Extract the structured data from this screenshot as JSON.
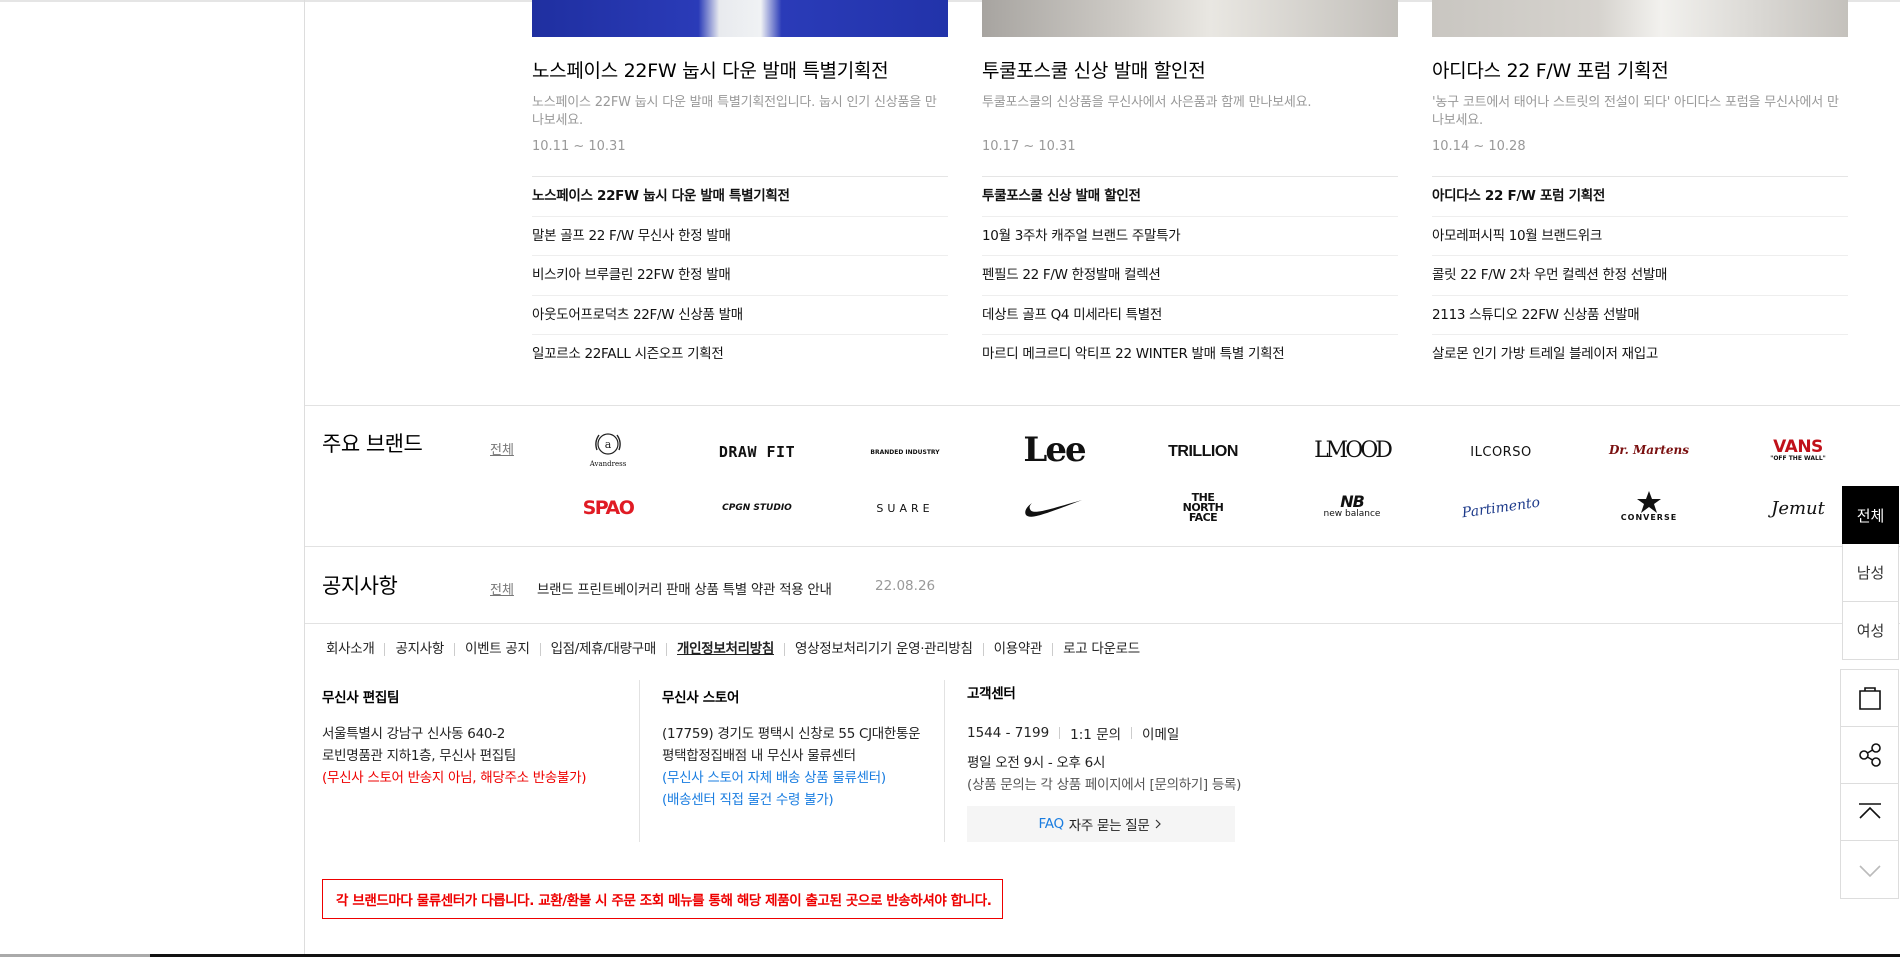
{
  "events": [
    {
      "title": "노스페이스 22FW 눕시 다운 발매 특별기획전",
      "desc": "노스페이스 22FW 눕시 다운 발매 특별기획전입니다. 눕시 인기 신상품을 만나보세요.",
      "date": "10.11 ~ 10.31",
      "links": [
        "노스페이스 22FW 눕시 다운 발매 특별기획전",
        "말본 골프 22 F/W 무신사 한정 발매",
        "비스키아 브루클린 22FW 한정 발매",
        "아웃도어프로덕츠 22F/W 신상품 발매",
        "일꼬르소 22FALL 시즌오프 기획전"
      ]
    },
    {
      "title": "투쿨포스쿨 신상 발매 할인전",
      "desc": "투쿨포스쿨의 신상품을 무신사에서 사은품과 함께 만나보세요.",
      "date": "10.17 ~ 10.31",
      "links": [
        "투쿨포스쿨 신상 발매 할인전",
        "10월 3주차 캐주얼 브랜드 주말특가",
        "펜필드 22 F/W 한정발매 컬렉션",
        "데상트 골프 Q4 미세라티 특별전",
        "마르디 메크르디 악티프 22 WINTER 발매 특별 기획전"
      ]
    },
    {
      "title": "아디다스 22 F/W 포럼 기획전",
      "desc": "'농구 코트에서 태어나 스트릿의 전설이 되다' 아디다스 포럼을 무신사에서 만나보세요.",
      "date": "10.14 ~ 10.28",
      "links": [
        "아디다스 22 F/W 포럼 기획전",
        "아모레퍼시픽 10월 브랜드위크",
        "콜릿 22 F/W 2차 우먼 컬렉션 한정 선발매",
        "2113 스튜디오 22FW 신상품 선발매",
        "살로몬 인기 가방 트레일 블레이저 재입고"
      ]
    }
  ],
  "brands": {
    "title": "주요 브랜드",
    "see_all": "전체",
    "row1": [
      "Avandress",
      "DRAW FIT",
      "BRANDED INDUSTRY",
      "Lee",
      "TRILLION",
      "LMOOD",
      "ILCORSO",
      "Dr. Martens",
      "VANS"
    ],
    "vans_sub": "\"OFF THE WALL\"",
    "row2": [
      "SPAO",
      "CPGN STUDIO",
      "SUARE",
      "Nike",
      "THE NORTH FACE",
      "new balance",
      "Partimento",
      "CONVERSE",
      "Jemut"
    ]
  },
  "notice": {
    "title": "공지사항",
    "see_all": "전체",
    "text": "브랜드 프린트베이커리 판매 상품 특별 약관 적용 안내",
    "date": "22.08.26"
  },
  "footer": {
    "links": [
      "회사소개",
      "공지사항",
      "이벤트 공지",
      "입점/제휴/대량구매",
      "개인정보처리방침",
      "영상정보처리기기 운영·관리방침",
      "이용약관",
      "로고 다운로드"
    ],
    "col1": {
      "title": "무신사 편집팀",
      "line1": "서울특별시 강남구 신사동 640-2",
      "line2": "로빈명품관 지하1층, 무신사 편집팀",
      "note": "(무신사 스토어 반송지 아님, 해당주소 반송불가)"
    },
    "col2": {
      "title": "무신사 스토어",
      "line1": "(17759) 경기도 평택시 신창로 55 CJ대한통운",
      "line2": "평택합정집배점 내 무신사 물류센터",
      "note1": "(무신사 스토어 자체 배송 상품 물류센터)",
      "note2": "(배송센터 직접 물건 수령 불가)"
    },
    "col3": {
      "title": "고객센터",
      "phone": "1544 - 7199",
      "inquiry": "1:1 문의",
      "email": "이메일",
      "hours": "평일 오전 9시 - 오후 6시",
      "note": "(상품 문의는 각 상품 페이지에서 [문의하기] 등록)",
      "faq_label": "FAQ",
      "faq_text": "자주 묻는 질문"
    },
    "warning": "각 브랜드마다 물류센터가 다릅니다. 교환/환불 시 주문 조회 메뉴를 통해 해당 제품이 출고된 곳으로 반송하셔야 합니다."
  },
  "side": {
    "tabs": [
      "전체",
      "남성",
      "여성"
    ]
  },
  "icons": [
    "shopping-bag-icon",
    "share-icon",
    "scroll-top-icon",
    "chevron-down-icon",
    "chevron-right-icon"
  ],
  "colors": {
    "warning_red": "#ee0000",
    "link_blue": "#1a7de0",
    "active_tab": "#000000"
  }
}
